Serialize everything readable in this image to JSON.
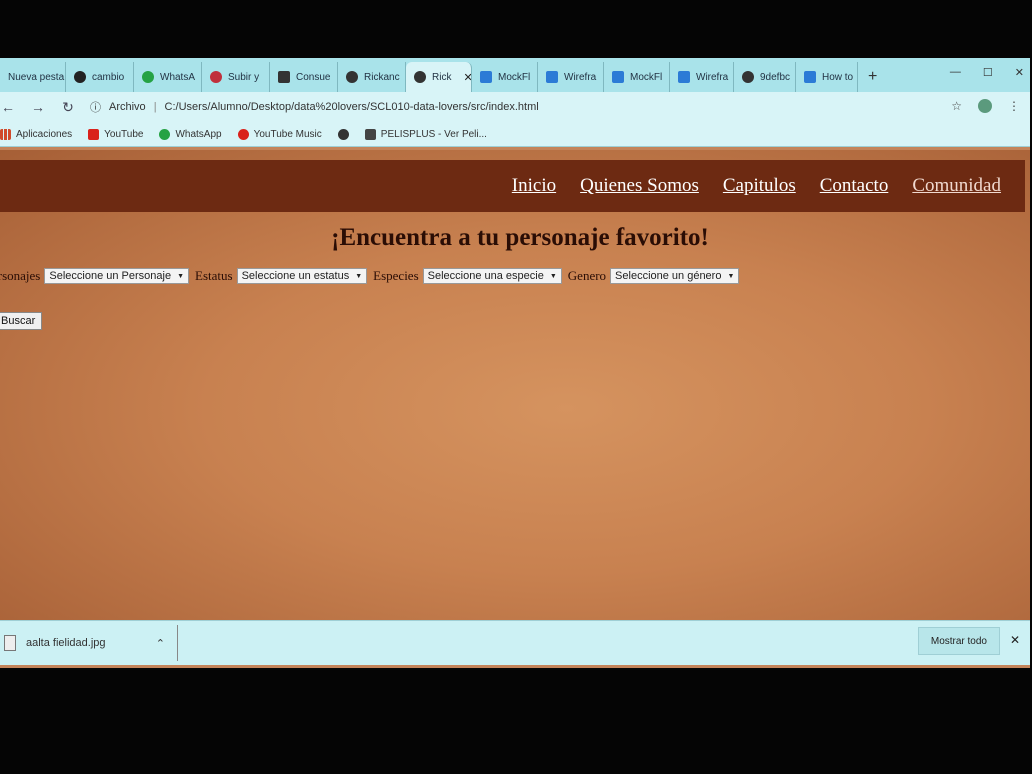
{
  "tabs": [
    {
      "label": "Nueva pesta",
      "icon": "blank-icon",
      "color": "#a9e3ea"
    },
    {
      "label": "cambio",
      "icon": "github-icon",
      "color": "#222222"
    },
    {
      "label": "WhatsA",
      "icon": "whatsapp-icon",
      "color": "#25a244"
    },
    {
      "label": "Subir y",
      "icon": "slack-icon",
      "color": "#c0303c"
    },
    {
      "label": "Consue",
      "icon": "app-icon",
      "color": "#333333"
    },
    {
      "label": "Rickanc",
      "icon": "globe-icon",
      "color": "#333333"
    },
    {
      "label": "Rick",
      "icon": "globe-icon",
      "color": "#333333",
      "active": true
    },
    {
      "label": "MockFl",
      "icon": "mockflow-icon",
      "color": "#2b7bd6"
    },
    {
      "label": "Wirefra",
      "icon": "wireframe-icon",
      "color": "#2b7bd6"
    },
    {
      "label": "MockFl",
      "icon": "mockflow-icon",
      "color": "#2b7bd6"
    },
    {
      "label": "Wirefra",
      "icon": "wireframe-icon",
      "color": "#2b7bd6"
    },
    {
      "label": "9defbc",
      "icon": "globe-icon",
      "color": "#333333"
    },
    {
      "label": "How to",
      "icon": "mockflow-icon",
      "color": "#2b7bd6"
    }
  ],
  "omnibox": {
    "scheme_label": "Archivo",
    "url": "C:/Users/Alumno/Desktop/data%20lovers/SCL010-data-lovers/src/index.html"
  },
  "bookmarks": [
    {
      "label": "Aplicaciones",
      "icon": "apps-grid-icon",
      "color": "#d04a2a"
    },
    {
      "label": "YouTube",
      "icon": "youtube-icon",
      "color": "#d9221b"
    },
    {
      "label": "WhatsApp",
      "icon": "whatsapp-icon",
      "color": "#25a244"
    },
    {
      "label": "YouTube Music",
      "icon": "youtube-music-icon",
      "color": "#d9221b"
    },
    {
      "label": "",
      "icon": "globe-icon",
      "color": "#333333"
    },
    {
      "label": "PELISPLUS - Ver Peli...",
      "icon": "pelisplus-icon",
      "color": "#444444"
    }
  ],
  "site": {
    "nav": [
      "Inicio",
      "Quienes Somos",
      "Capitulos",
      "Contacto",
      "Comunidad"
    ],
    "headline": "¡Encuentra a tu personaje favorito!",
    "filters": [
      {
        "label": "ersonajes",
        "selected": "Seleccione un Personaje"
      },
      {
        "label": "Estatus",
        "selected": "Seleccione un estatus"
      },
      {
        "label": "Especies",
        "selected": "Seleccione una especie"
      },
      {
        "label": "Genero",
        "selected": "Seleccione un género"
      }
    ],
    "search_button": "Buscar",
    "header_color": "#6d2a12",
    "page_color": "#c88150"
  },
  "downloads": {
    "file_name": "aalta fielidad.jpg",
    "show_all": "Mostrar todo"
  }
}
